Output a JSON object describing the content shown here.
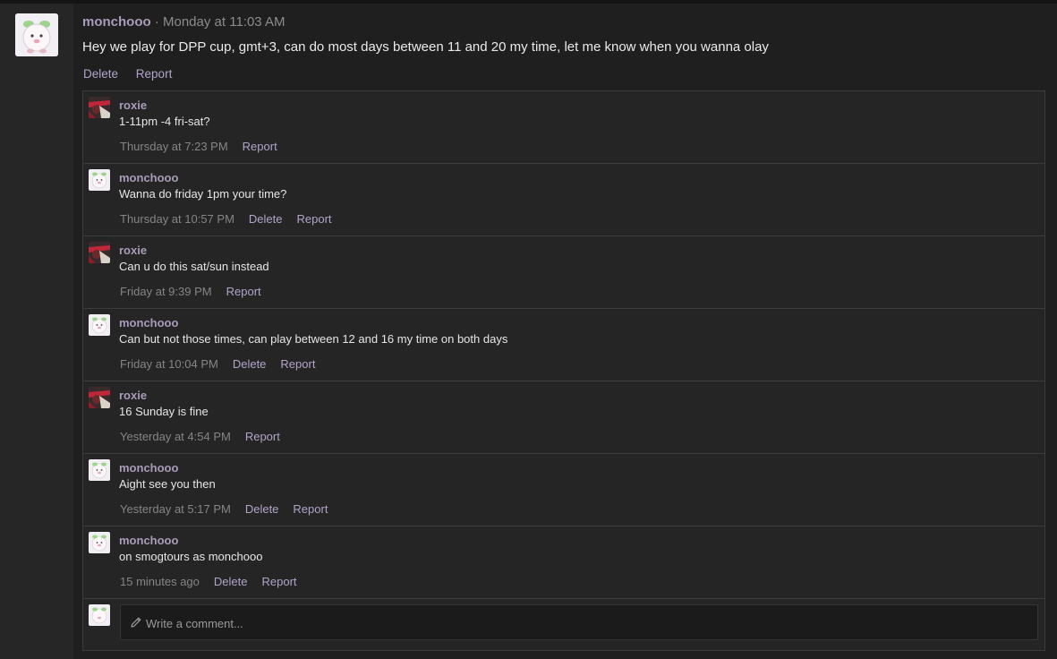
{
  "post": {
    "author": "monchooo",
    "separator": "·",
    "time": "Monday at 11:03 AM",
    "text": "Hey we play for DPP cup, gmt+3, can do most days between 11 and 20 my time, let me know when you wanna olay",
    "actions": {
      "delete": "Delete",
      "report": "Report"
    }
  },
  "comments": [
    {
      "author": "roxie",
      "avatar": "roxie-avatar",
      "text": "1-11pm -4 fri-sat?",
      "time": "Thursday at 7:23 PM",
      "delete": null,
      "report": "Report"
    },
    {
      "author": "monchooo",
      "avatar": "monchooo-avatar",
      "text": "Wanna do friday 1pm your time?",
      "time": "Thursday at 10:57 PM",
      "delete": "Delete",
      "report": "Report"
    },
    {
      "author": "roxie",
      "avatar": "roxie-avatar",
      "text": "Can u do this sat/sun instead",
      "time": "Friday at 9:39 PM",
      "delete": null,
      "report": "Report"
    },
    {
      "author": "monchooo",
      "avatar": "monchooo-avatar",
      "text": "Can but not those times, can play between 12 and 16 my time on both days",
      "time": "Friday at 10:04 PM",
      "delete": "Delete",
      "report": "Report"
    },
    {
      "author": "roxie",
      "avatar": "roxie-avatar",
      "text": "16 Sunday is fine",
      "time": "Yesterday at 4:54 PM",
      "delete": null,
      "report": "Report"
    },
    {
      "author": "monchooo",
      "avatar": "monchooo-avatar",
      "text": "Aight see you then",
      "time": "Yesterday at 5:17 PM",
      "delete": "Delete",
      "report": "Report"
    },
    {
      "author": "monchooo",
      "avatar": "monchooo-avatar",
      "text": "on smogtours as monchooo",
      "time": "15 minutes ago",
      "delete": "Delete",
      "report": "Report"
    }
  ],
  "reply": {
    "placeholder": "Write a comment...",
    "icon": "pencil-icon"
  },
  "colors": {
    "accent": "#a99bb9",
    "link": "#b2a4c9",
    "background": "#1f1f1f"
  }
}
